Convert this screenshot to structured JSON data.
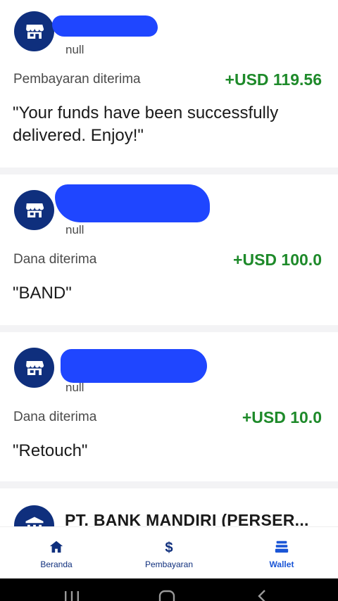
{
  "transactions": [
    {
      "merchant_subtitle": "null",
      "status": "Pembayaran diterima",
      "amount": "+USD 119.56",
      "note": "\"Your funds have been successfully delivered. Enjoy!\""
    },
    {
      "merchant_subtitle": "null",
      "status": "Dana diterima",
      "amount": "+USD 100.0",
      "note": "\"BAND\""
    },
    {
      "merchant_subtitle": "null",
      "status": "Dana diterima",
      "amount": "+USD 10.0",
      "note": "\"Retouch\""
    },
    {
      "merchant_name": "PT. BANK MANDIRI (PERSER..."
    }
  ],
  "nav": {
    "items": [
      {
        "label": "Beranda",
        "icon": "home-icon"
      },
      {
        "label": "Pembayaran",
        "icon": "dollar-icon"
      },
      {
        "label": "Wallet",
        "icon": "wallet-icon",
        "active": true
      }
    ]
  },
  "system_nav": {
    "buttons": [
      "recents-icon",
      "home-icon",
      "back-icon"
    ]
  },
  "colors": {
    "primary": "#0f2f7d",
    "accent": "#1a55d6",
    "amount_green": "#1e8a2a",
    "redaction_blue": "#1f46ff"
  }
}
